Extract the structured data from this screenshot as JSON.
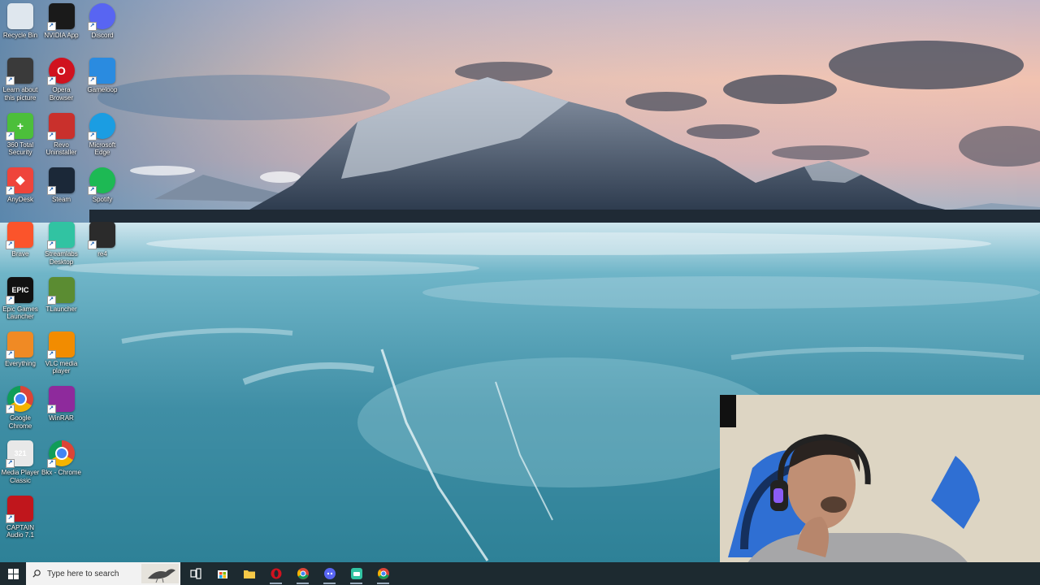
{
  "desktop": {
    "icons": [
      {
        "label": "Recycle Bin",
        "icon": "recycle-bin-icon",
        "color": "#dfe7ee"
      },
      {
        "label": "NVIDIA App",
        "icon": "nvidia-icon",
        "color": "#1a1a1a"
      },
      {
        "label": "Discord",
        "icon": "discord-icon",
        "color": "#5865f2"
      },
      {
        "label": "Learn about this picture",
        "icon": "camera-icon",
        "color": "#3a3a3a"
      },
      {
        "label": "Opera Browser",
        "icon": "opera-icon",
        "color": "#d0121f"
      },
      {
        "label": "Gameloop",
        "icon": "gameloop-icon",
        "color": "#2a8be0"
      },
      {
        "label": "360 Total Security",
        "icon": "shield-plus-icon",
        "color": "#4cbf3a"
      },
      {
        "label": "Revo Uninstaller",
        "icon": "revo-icon",
        "color": "#c9302c"
      },
      {
        "label": "Microsoft Edge",
        "icon": "edge-icon",
        "color": "#1b9de2"
      },
      {
        "label": "AnyDesk",
        "icon": "anydesk-icon",
        "color": "#ef443b"
      },
      {
        "label": "Steam",
        "icon": "steam-icon",
        "color": "#1b2838"
      },
      {
        "label": "Spotify",
        "icon": "spotify-icon",
        "color": "#1db954"
      },
      {
        "label": "Brave",
        "icon": "brave-icon",
        "color": "#fb542b"
      },
      {
        "label": "Streamlabs Desktop",
        "icon": "streamlabs-icon",
        "color": "#31c3a2"
      },
      {
        "label": "re4",
        "icon": "game-thumbnail-icon",
        "color": "#2b2b2b"
      },
      {
        "label": "Epic Games Launcher",
        "icon": "epic-games-icon",
        "color": "#111111"
      },
      {
        "label": "TLauncher",
        "icon": "minecraft-block-icon",
        "color": "#5b8c32"
      },
      {
        "label": "Everything",
        "icon": "magnifier-icon",
        "color": "#f08a24"
      },
      {
        "label": "VLC media player",
        "icon": "vlc-cone-icon",
        "color": "#f28c00"
      },
      {
        "label": "Google Chrome",
        "icon": "chrome-icon",
        "color": "#4285f4"
      },
      {
        "label": "WinRAR",
        "icon": "winrar-icon",
        "color": "#8e2a9c"
      },
      {
        "label": "Media Player Classic",
        "icon": "mpc-icon",
        "color": "#e8e8e8"
      },
      {
        "label": "Bkx - Chrome",
        "icon": "chrome-icon",
        "color": "#4285f4"
      },
      {
        "label": "CAPTAIN Audio 7.1",
        "icon": "captain-audio-icon",
        "color": "#c0161c"
      }
    ],
    "icon_glyphs": [
      "",
      "",
      "",
      "",
      "O",
      "",
      "+",
      "",
      "",
      "◆",
      "",
      "",
      "",
      "",
      "",
      "EPIC",
      "",
      "",
      "",
      "",
      "",
      "321",
      "",
      ""
    ]
  },
  "taskbar": {
    "search_placeholder": "Type here to search",
    "items": [
      {
        "name": "task-view",
        "icon": "task-view-icon"
      },
      {
        "name": "microsoft-store",
        "icon": "store-icon"
      },
      {
        "name": "file-explorer",
        "icon": "folder-icon"
      },
      {
        "name": "opera",
        "icon": "opera-icon"
      },
      {
        "name": "chrome",
        "icon": "chrome-icon"
      },
      {
        "name": "discord",
        "icon": "discord-icon"
      },
      {
        "name": "streamlabs",
        "icon": "streamlabs-icon"
      },
      {
        "name": "chrome-profile",
        "icon": "chrome-icon"
      }
    ]
  },
  "colors": {
    "taskbar_bg": "#1d2a30",
    "search_bg": "#f2f2f2",
    "sky_top": "#f3c4b3",
    "lake_ice": "#5fb3c7"
  }
}
